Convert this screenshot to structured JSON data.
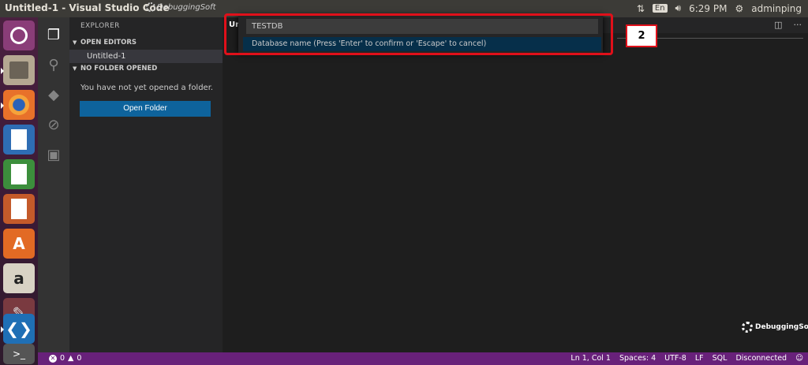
{
  "window": {
    "title": "Untitled-1 - Visual Studio Code",
    "watermark": "DebuggingSoft"
  },
  "tray": {
    "lang": "En",
    "time": "6:29 PM",
    "user": "adminping"
  },
  "sidebar": {
    "header": "EXPLORER",
    "open_editors": "OPEN EDITORS",
    "open_file": "Untitled-1",
    "no_folder": "NO FOLDER OPENED",
    "message": "You have not yet opened a folder.",
    "open_folder_button": "Open Folder"
  },
  "editor": {
    "tab_label": "Untitl"
  },
  "quick_input": {
    "value": "TESTDB",
    "hint": "Database name (Press 'Enter' to confirm or 'Escape' to cancel)"
  },
  "annotation": {
    "step": "2",
    "color": "#e0101a"
  },
  "status": {
    "errors": "0",
    "warnings": "0",
    "position": "Ln 1, Col 1",
    "spaces": "Spaces: 4",
    "encoding": "UTF-8",
    "eol": "LF",
    "language": "SQL",
    "connection": "Disconnected"
  },
  "colors": {
    "statusbar": "#68217a",
    "button": "#0e639c",
    "launcher": "#3a1a35"
  }
}
